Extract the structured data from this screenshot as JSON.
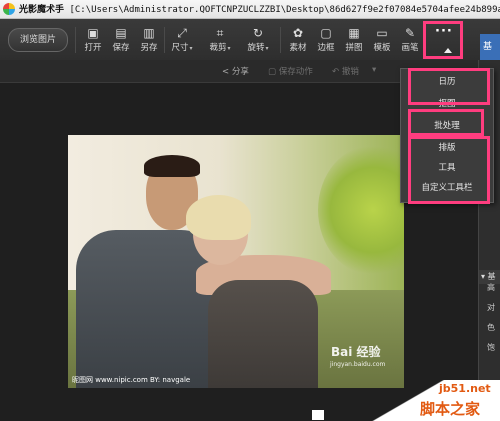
{
  "titlebar": {
    "app_name": "光影魔术手",
    "path": "[C:\\Users\\Administrator.QOFTCNPZUCLZZBI\\Desktop\\86d627f9e2f07084e5704afee24b899a801f2..."
  },
  "toolbar": {
    "browse_label": "浏览图片",
    "tools": [
      {
        "label": "打开",
        "icon": "open-icon",
        "glyph": "▣"
      },
      {
        "label": "保存",
        "icon": "save-icon",
        "glyph": "▤"
      },
      {
        "label": "另存",
        "icon": "save-as-icon",
        "glyph": "▥"
      },
      {
        "label": "尺寸",
        "icon": "resize-icon",
        "glyph": "⤢",
        "dropdown": true
      },
      {
        "label": "裁剪",
        "icon": "crop-icon",
        "glyph": "⌗",
        "dropdown": true
      },
      {
        "label": "旋转",
        "icon": "rotate-icon",
        "glyph": "↻",
        "dropdown": true
      },
      {
        "label": "素材",
        "icon": "material-icon",
        "glyph": "✿"
      },
      {
        "label": "边框",
        "icon": "border-icon",
        "glyph": "▢"
      },
      {
        "label": "拼图",
        "icon": "collage-icon",
        "glyph": "▦"
      },
      {
        "label": "模板",
        "icon": "template-icon",
        "glyph": "▭"
      },
      {
        "label": "画笔",
        "icon": "brush-icon",
        "glyph": "✎"
      }
    ],
    "more_glyph": "···",
    "right_tab_label": "基本"
  },
  "subbar": {
    "share": "分享",
    "save_action": "保存动作",
    "undo": "撤销",
    "undo_arrow": "↶",
    "dropdown_arrow": "▾"
  },
  "more_menu": {
    "items": [
      "日历",
      "抠图",
      "批处理",
      "排版",
      "工具",
      "自定义工具栏"
    ]
  },
  "side_panel": {
    "collapse_arrow": "◀",
    "header": "▾ 基",
    "labels": [
      "高",
      "对",
      "色",
      "饱"
    ]
  },
  "photo": {
    "watermark_left": "昵图网 www.nipic.com   BY: navgale",
    "watermark_baidu": "Bai 经验",
    "watermark_baidu_url": "jingyan.baidu.com"
  },
  "site_logo": {
    "url": "jb51.net",
    "name": "脚本之家"
  },
  "colors": {
    "highlight": "#ff3d7f",
    "accent": "#3a6fb7",
    "logo_orange": "#e25a12"
  }
}
